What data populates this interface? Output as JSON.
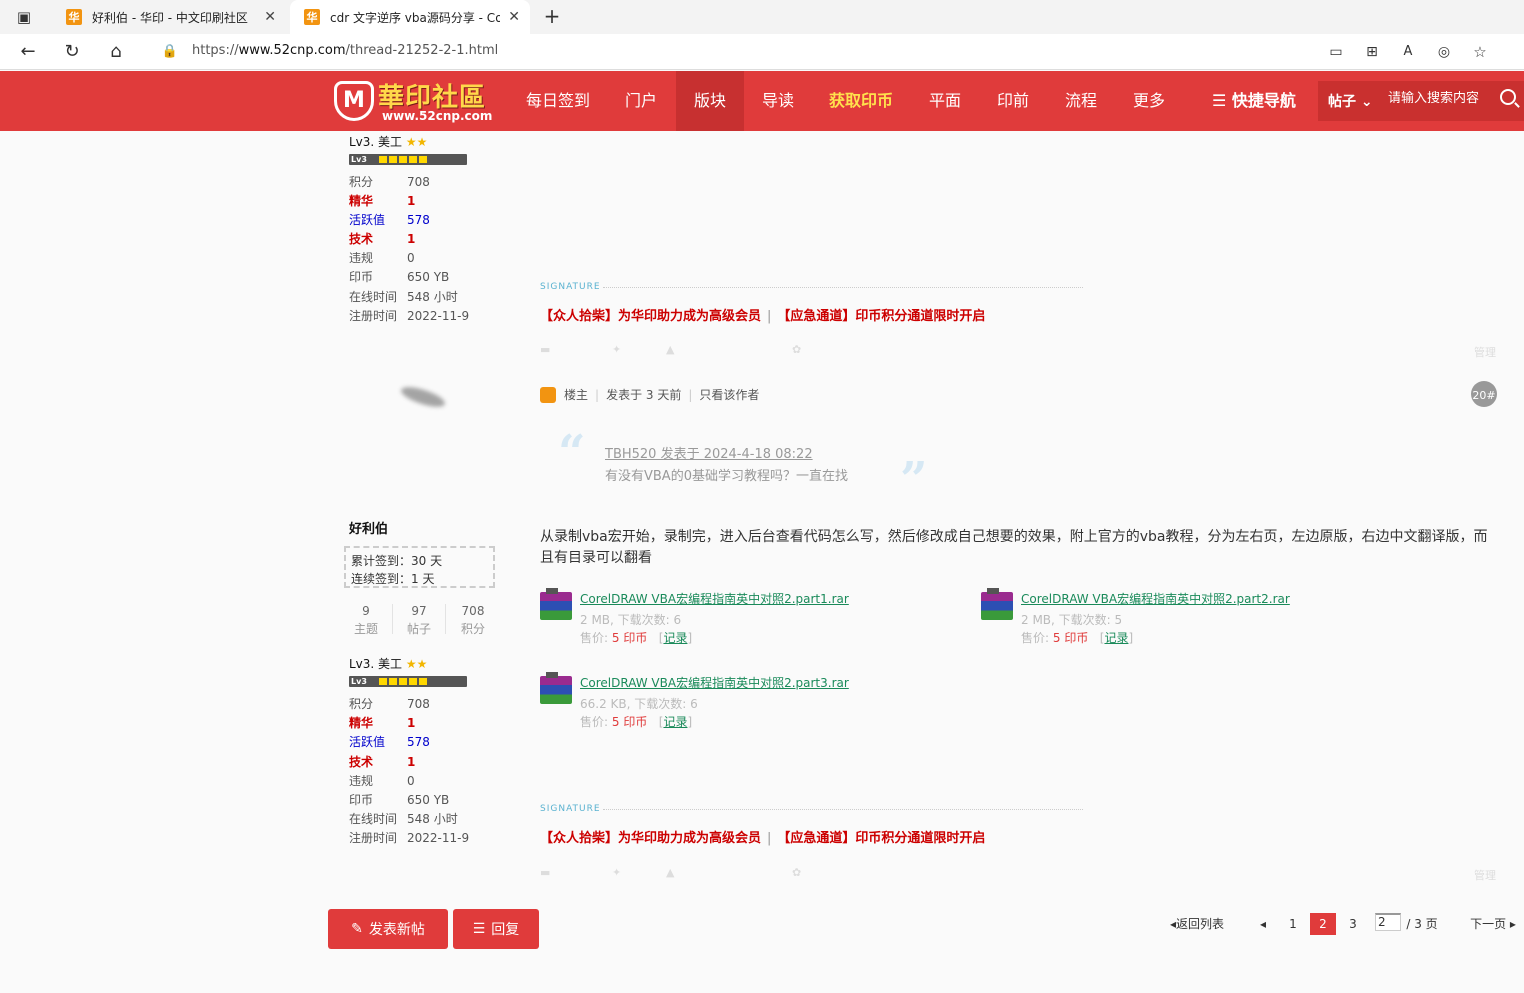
{
  "browser": {
    "tabs": [
      {
        "title": "好利伯 - 华印 - 中文印刷社区",
        "favicon": "华"
      },
      {
        "title": "cdr 文字逆序 vba源码分享 - Co",
        "favicon": "华"
      }
    ],
    "new_tab": "+",
    "url_prefix": "https://",
    "url_domain": "www.52cnp.com",
    "url_path": "/thread-21252-2-1.html"
  },
  "site": {
    "logo_title": "華印社區",
    "logo_url": "www.52cnp.com",
    "logo_mark": "M",
    "nav": [
      "每日签到",
      "门户",
      "版块",
      "导读",
      "获取印币",
      "平面",
      "印前",
      "流程",
      "更多"
    ],
    "quick_nav": "☰ 快捷导航",
    "search_type": "帖子 ⌄",
    "search_placeholder": "请输入搜索内容"
  },
  "post1": {
    "level": "Lv3. 美工",
    "lv_badge": "Lv3",
    "stats": [
      {
        "k": "积分",
        "v": "708"
      },
      {
        "k": "精华",
        "v": "1"
      },
      {
        "k": "活跃值",
        "v": "578"
      },
      {
        "k": "技术",
        "v": "1"
      },
      {
        "k": "违规",
        "v": "0"
      },
      {
        "k": "印币",
        "v": "650 YB"
      },
      {
        "k": "在线时间",
        "v": "548 小时"
      },
      {
        "k": "注册时间",
        "v": "2022-11-9"
      }
    ],
    "signature_label": "SIGNATURE",
    "sig1": "【众人拾柴】为华印助力成为高级会员",
    "sig_sep": "|",
    "sig2": "【应急通道】印币积分通道限时开启",
    "manage": "管理"
  },
  "post2": {
    "meta_role": "楼主",
    "meta_time": "发表于 3 天前",
    "meta_only_author": "只看该作者",
    "floor": "20#",
    "quote_open": "“",
    "quote_close": "”",
    "quote_author": "TBH520 发表于 2024-4-18 08:22",
    "quote_body": "有没有VBA的0基础学习教程吗？一直在找",
    "author_name": "好利伯",
    "checkin_total": "累计签到：30 天",
    "checkin_streak": "连续签到：1 天",
    "counters": [
      {
        "n": "9",
        "label": "主题"
      },
      {
        "n": "97",
        "label": "帖子"
      },
      {
        "n": "708",
        "label": "积分"
      }
    ],
    "body": "从录制vba宏开始，录制完，进入后台查看代码怎么写，然后修改成自己想要的效果，附上官方的vba教程，分为左右页，左边原版，右边中文翻译版，而且有目录可以翻看",
    "attachments": [
      {
        "name": "CorelDRAW VBA宏编程指南英中对照2.part1.rar",
        "meta": "2 MB, 下载次数: 6",
        "price_label": "售价:",
        "price": "5 印币",
        "record": "记录"
      },
      {
        "name": "CorelDRAW VBA宏编程指南英中对照2.part2.rar",
        "meta": "2 MB, 下载次数: 5",
        "price_label": "售价:",
        "price": "5 印币",
        "record": "记录"
      },
      {
        "name": "CorelDRAW VBA宏编程指南英中对照2.part3.rar",
        "meta": "66.2 KB, 下载次数: 6",
        "price_label": "售价:",
        "price": "5 印币",
        "record": "记录"
      }
    ],
    "level": "Lv3. 美工",
    "lv_badge": "Lv3",
    "stats": [
      {
        "k": "积分",
        "v": "708"
      },
      {
        "k": "精华",
        "v": "1"
      },
      {
        "k": "活跃值",
        "v": "578"
      },
      {
        "k": "技术",
        "v": "1"
      },
      {
        "k": "违规",
        "v": "0"
      },
      {
        "k": "印币",
        "v": "650 YB"
      },
      {
        "k": "在线时间",
        "v": "548 小时"
      },
      {
        "k": "注册时间",
        "v": "2022-11-9"
      }
    ],
    "signature_label": "SIGNATURE",
    "sig1": "【众人拾柴】为华印助力成为高级会员",
    "sig_sep": "|",
    "sig2": "【应急通道】印币积分通道限时开启",
    "manage": "管理"
  },
  "footer": {
    "new_post": "发表新帖",
    "reply": "回复",
    "back_list": "返回列表",
    "pages": [
      "1",
      "2",
      "3"
    ],
    "current_page": "2",
    "jump_value": "2",
    "total_pages": "/ 3 页",
    "next": "下一页"
  },
  "colors": {
    "brand_red": "#e03b3b",
    "active_nav": "#c73030",
    "gold": "#ffe14d",
    "link_green": "#1a8a5a"
  }
}
